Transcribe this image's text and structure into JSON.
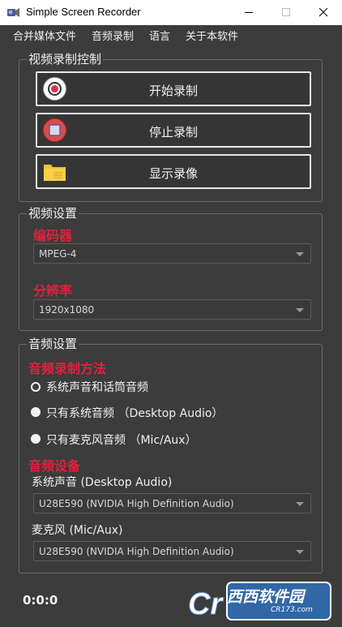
{
  "window": {
    "title": "Simple Screen Recorder"
  },
  "menu": {
    "items": [
      "合并媒体文件",
      "音频录制",
      "语言",
      "关于本软件"
    ]
  },
  "record_control": {
    "title": "视频录制控制",
    "start_label": "开始录制",
    "stop_label": "停止录制",
    "show_label": "显示录像"
  },
  "video_settings": {
    "title": "视频设置",
    "codec_label": "编码器",
    "codec_value": "MPEG-4",
    "resolution_label": "分辨率",
    "resolution_value": "1920x1080"
  },
  "audio_settings": {
    "title": "音频设置",
    "method_label": "音频录制方法",
    "options": [
      "系统声音和话筒音频",
      "只有系统音频 （Desktop Audio）",
      "只有麦克风音频 （Mic/Aux）"
    ],
    "selected_option": 0,
    "device_label": "音频设备",
    "system_label": "系统声音 (Desktop Audio)",
    "system_value": "U28E590 (NVIDIA High Definition Audio)",
    "mic_label": "麦克风 (Mic/Aux)",
    "mic_value": "U28E590 (NVIDIA High Definition Audio)"
  },
  "status": {
    "time": "0:0:0"
  },
  "watermark": {
    "text": "西西软件园",
    "sub": "CR173.com"
  },
  "colors": {
    "background": "#3c3c3c",
    "accent_red": "#e3203a",
    "border": "#6a6a6a"
  }
}
